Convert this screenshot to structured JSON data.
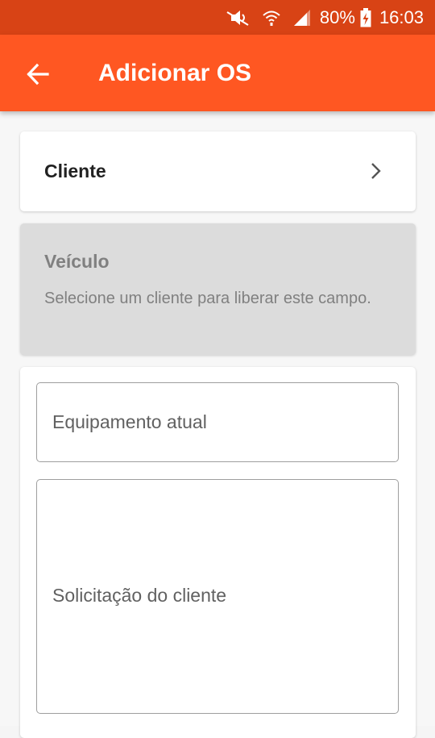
{
  "status_bar": {
    "icons": [
      "mute-icon",
      "wifi-icon",
      "signal-icon",
      "battery-charging-icon"
    ],
    "battery": "80%",
    "time": "16:03"
  },
  "app_bar": {
    "title": "Adicionar OS",
    "back_icon": "arrow-left-icon",
    "color": "#ff5722"
  },
  "cliente": {
    "label": "Cliente",
    "chevron_icon": "chevron-right-icon"
  },
  "veiculo": {
    "label": "Veículo",
    "hint": "Selecione um cliente para liberar este campo."
  },
  "form": {
    "equipamento_placeholder": "Equipamento atual",
    "solicitacao_placeholder": "Solicitação do cliente"
  }
}
